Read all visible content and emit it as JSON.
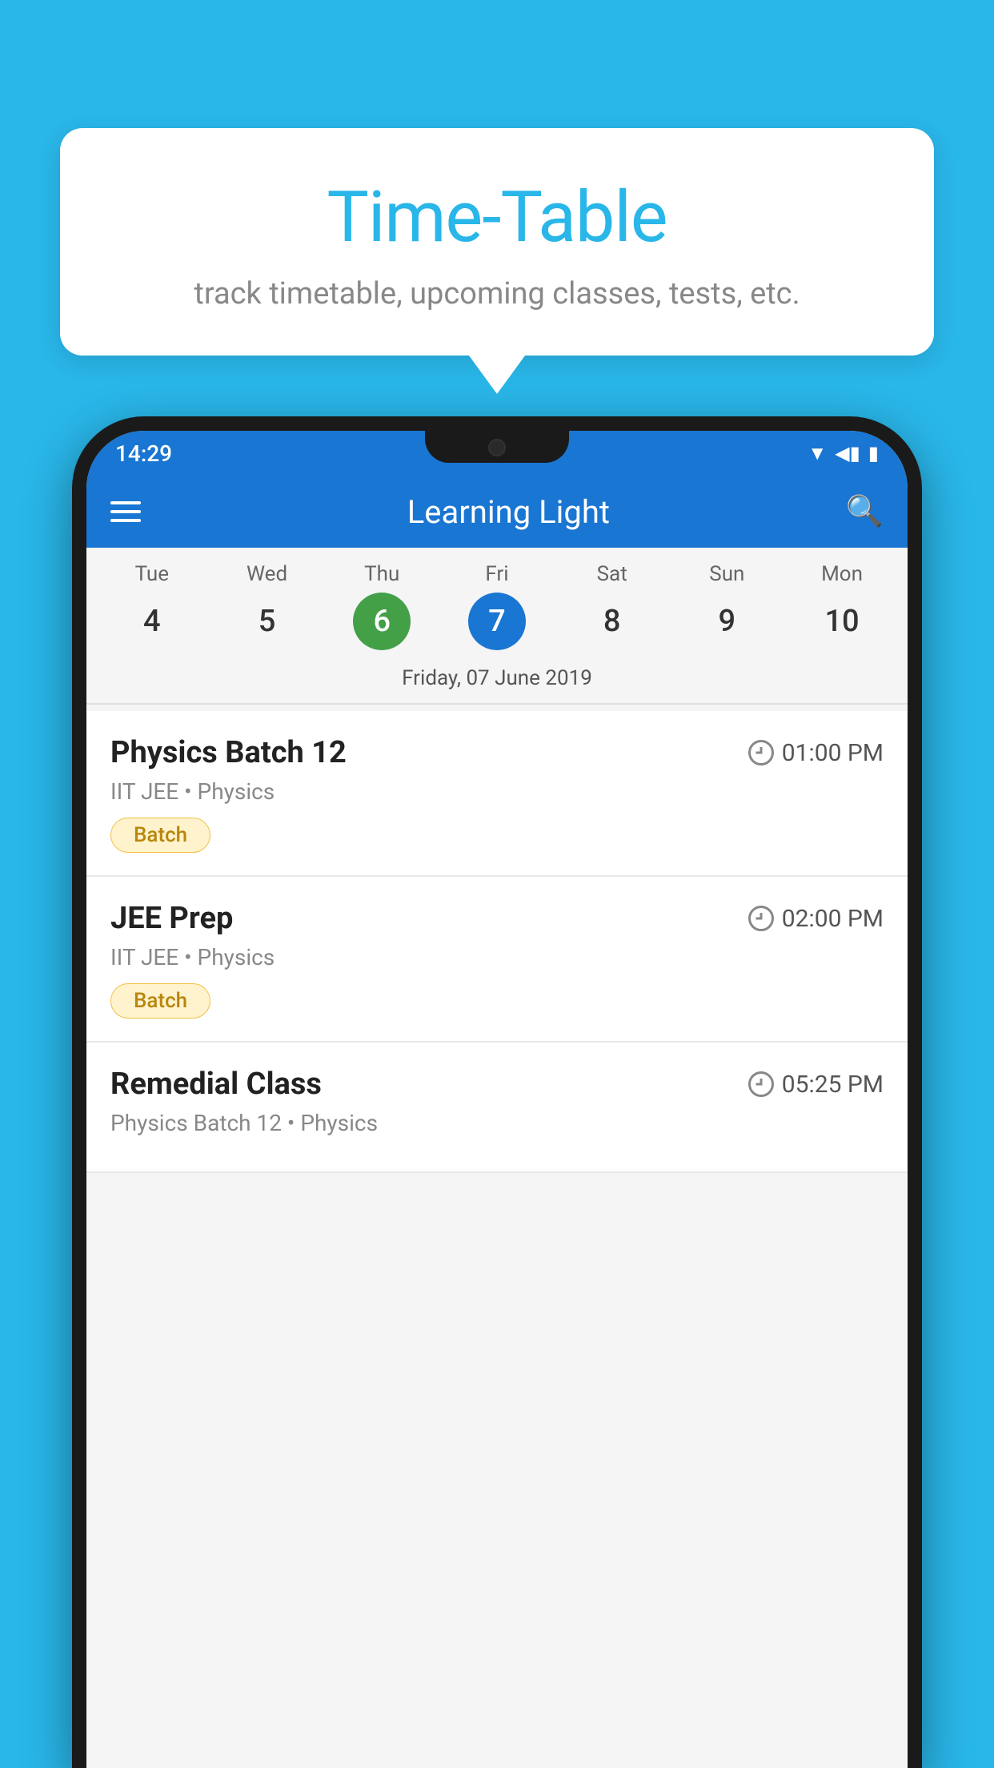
{
  "background_color": "#29b6e8",
  "bubble": {
    "title": "Time-Table",
    "subtitle": "track timetable, upcoming classes, tests, etc."
  },
  "phone": {
    "status_bar": {
      "time": "14:29"
    },
    "app_bar": {
      "title": "Learning Light"
    },
    "calendar": {
      "days": [
        {
          "name": "Tue",
          "num": "4",
          "state": "normal"
        },
        {
          "name": "Wed",
          "num": "5",
          "state": "normal"
        },
        {
          "name": "Thu",
          "num": "6",
          "state": "today"
        },
        {
          "name": "Fri",
          "num": "7",
          "state": "selected"
        },
        {
          "name": "Sat",
          "num": "8",
          "state": "normal"
        },
        {
          "name": "Sun",
          "num": "9",
          "state": "normal"
        },
        {
          "name": "Mon",
          "num": "10",
          "state": "normal"
        }
      ],
      "date_label": "Friday, 07 June 2019"
    },
    "schedule": [
      {
        "title": "Physics Batch 12",
        "time": "01:00 PM",
        "meta": "IIT JEE • Physics",
        "badge": "Batch"
      },
      {
        "title": "JEE Prep",
        "time": "02:00 PM",
        "meta": "IIT JEE • Physics",
        "badge": "Batch"
      },
      {
        "title": "Remedial Class",
        "time": "05:25 PM",
        "meta": "Physics Batch 12 • Physics",
        "badge": ""
      }
    ]
  }
}
